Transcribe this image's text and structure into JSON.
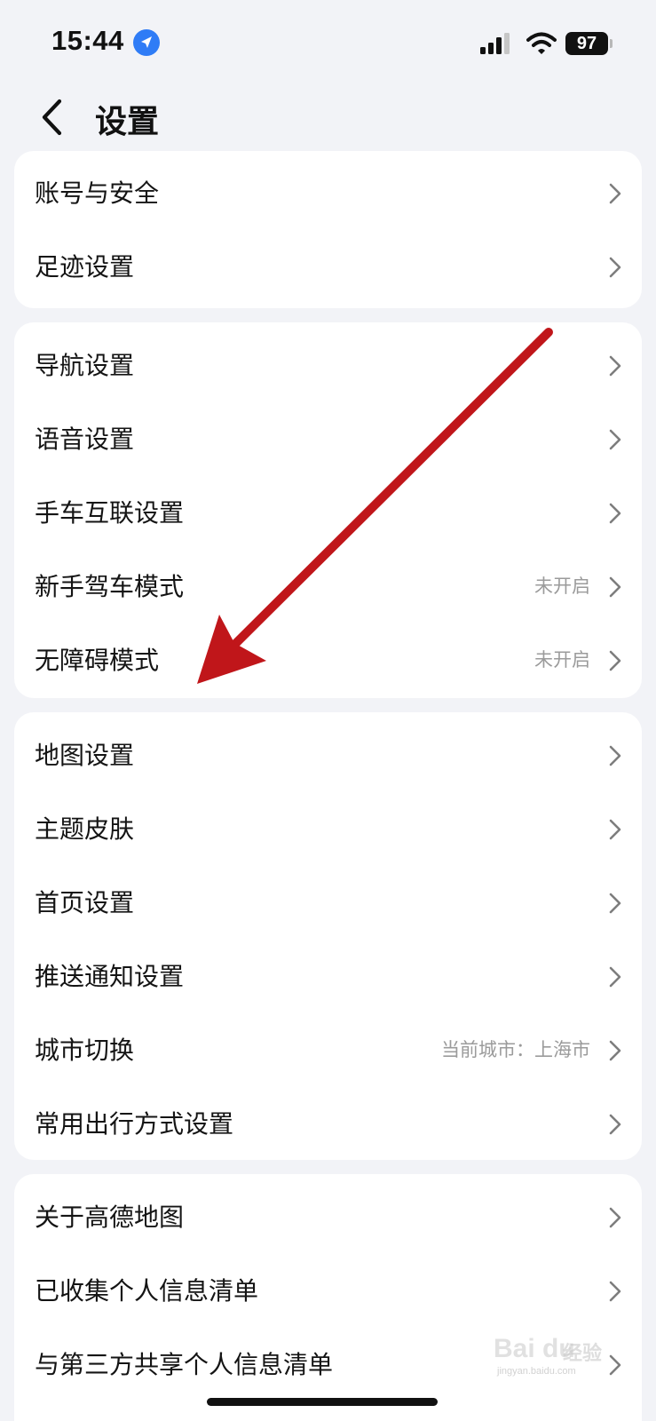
{
  "status_bar": {
    "time": "15:44",
    "battery": "97"
  },
  "nav": {
    "title": "设置"
  },
  "sections": [
    {
      "items": [
        {
          "label": "账号与安全",
          "value": ""
        },
        {
          "label": "足迹设置",
          "value": ""
        }
      ]
    },
    {
      "items": [
        {
          "label": "导航设置",
          "value": ""
        },
        {
          "label": "语音设置",
          "value": ""
        },
        {
          "label": "手车互联设置",
          "value": ""
        },
        {
          "label": "新手驾车模式",
          "value": "未开启"
        },
        {
          "label": "无障碍模式",
          "value": "未开启"
        }
      ]
    },
    {
      "items": [
        {
          "label": "地图设置",
          "value": ""
        },
        {
          "label": "主题皮肤",
          "value": ""
        },
        {
          "label": "首页设置",
          "value": ""
        },
        {
          "label": "推送通知设置",
          "value": ""
        },
        {
          "label": "城市切换",
          "value": "当前城市：上海市"
        },
        {
          "label": "常用出行方式设置",
          "value": ""
        }
      ]
    },
    {
      "items": [
        {
          "label": "关于高德地图",
          "value": ""
        },
        {
          "label": "已收集个人信息清单",
          "value": ""
        },
        {
          "label": "与第三方共享个人信息清单",
          "value": ""
        }
      ]
    }
  ],
  "watermark": {
    "logo": "Bai du",
    "text": "经验",
    "url": "jingyan.baidu.com"
  },
  "colors": {
    "background": "#f2f3f7",
    "card": "#ffffff",
    "accent_location": "#2f7cf6",
    "annotation_arrow": "#c0161a"
  },
  "icons": {
    "back": "chevron-left-icon",
    "row": "chevron-right-icon",
    "location": "location-arrow-icon",
    "signal": "cellular-signal-icon",
    "wifi": "wifi-icon"
  }
}
